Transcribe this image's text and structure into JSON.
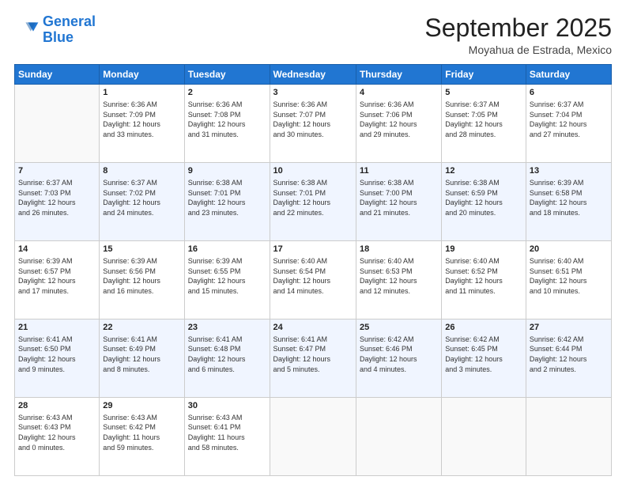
{
  "logo": {
    "line1": "General",
    "line2": "Blue"
  },
  "title": "September 2025",
  "location": "Moyahua de Estrada, Mexico",
  "days_header": [
    "Sunday",
    "Monday",
    "Tuesday",
    "Wednesday",
    "Thursday",
    "Friday",
    "Saturday"
  ],
  "weeks": [
    [
      {
        "day": "",
        "text": ""
      },
      {
        "day": "1",
        "text": "Sunrise: 6:36 AM\nSunset: 7:09 PM\nDaylight: 12 hours\nand 33 minutes."
      },
      {
        "day": "2",
        "text": "Sunrise: 6:36 AM\nSunset: 7:08 PM\nDaylight: 12 hours\nand 31 minutes."
      },
      {
        "day": "3",
        "text": "Sunrise: 6:36 AM\nSunset: 7:07 PM\nDaylight: 12 hours\nand 30 minutes."
      },
      {
        "day": "4",
        "text": "Sunrise: 6:36 AM\nSunset: 7:06 PM\nDaylight: 12 hours\nand 29 minutes."
      },
      {
        "day": "5",
        "text": "Sunrise: 6:37 AM\nSunset: 7:05 PM\nDaylight: 12 hours\nand 28 minutes."
      },
      {
        "day": "6",
        "text": "Sunrise: 6:37 AM\nSunset: 7:04 PM\nDaylight: 12 hours\nand 27 minutes."
      }
    ],
    [
      {
        "day": "7",
        "text": "Sunrise: 6:37 AM\nSunset: 7:03 PM\nDaylight: 12 hours\nand 26 minutes."
      },
      {
        "day": "8",
        "text": "Sunrise: 6:37 AM\nSunset: 7:02 PM\nDaylight: 12 hours\nand 24 minutes."
      },
      {
        "day": "9",
        "text": "Sunrise: 6:38 AM\nSunset: 7:01 PM\nDaylight: 12 hours\nand 23 minutes."
      },
      {
        "day": "10",
        "text": "Sunrise: 6:38 AM\nSunset: 7:01 PM\nDaylight: 12 hours\nand 22 minutes."
      },
      {
        "day": "11",
        "text": "Sunrise: 6:38 AM\nSunset: 7:00 PM\nDaylight: 12 hours\nand 21 minutes."
      },
      {
        "day": "12",
        "text": "Sunrise: 6:38 AM\nSunset: 6:59 PM\nDaylight: 12 hours\nand 20 minutes."
      },
      {
        "day": "13",
        "text": "Sunrise: 6:39 AM\nSunset: 6:58 PM\nDaylight: 12 hours\nand 18 minutes."
      }
    ],
    [
      {
        "day": "14",
        "text": "Sunrise: 6:39 AM\nSunset: 6:57 PM\nDaylight: 12 hours\nand 17 minutes."
      },
      {
        "day": "15",
        "text": "Sunrise: 6:39 AM\nSunset: 6:56 PM\nDaylight: 12 hours\nand 16 minutes."
      },
      {
        "day": "16",
        "text": "Sunrise: 6:39 AM\nSunset: 6:55 PM\nDaylight: 12 hours\nand 15 minutes."
      },
      {
        "day": "17",
        "text": "Sunrise: 6:40 AM\nSunset: 6:54 PM\nDaylight: 12 hours\nand 14 minutes."
      },
      {
        "day": "18",
        "text": "Sunrise: 6:40 AM\nSunset: 6:53 PM\nDaylight: 12 hours\nand 12 minutes."
      },
      {
        "day": "19",
        "text": "Sunrise: 6:40 AM\nSunset: 6:52 PM\nDaylight: 12 hours\nand 11 minutes."
      },
      {
        "day": "20",
        "text": "Sunrise: 6:40 AM\nSunset: 6:51 PM\nDaylight: 12 hours\nand 10 minutes."
      }
    ],
    [
      {
        "day": "21",
        "text": "Sunrise: 6:41 AM\nSunset: 6:50 PM\nDaylight: 12 hours\nand 9 minutes."
      },
      {
        "day": "22",
        "text": "Sunrise: 6:41 AM\nSunset: 6:49 PM\nDaylight: 12 hours\nand 8 minutes."
      },
      {
        "day": "23",
        "text": "Sunrise: 6:41 AM\nSunset: 6:48 PM\nDaylight: 12 hours\nand 6 minutes."
      },
      {
        "day": "24",
        "text": "Sunrise: 6:41 AM\nSunset: 6:47 PM\nDaylight: 12 hours\nand 5 minutes."
      },
      {
        "day": "25",
        "text": "Sunrise: 6:42 AM\nSunset: 6:46 PM\nDaylight: 12 hours\nand 4 minutes."
      },
      {
        "day": "26",
        "text": "Sunrise: 6:42 AM\nSunset: 6:45 PM\nDaylight: 12 hours\nand 3 minutes."
      },
      {
        "day": "27",
        "text": "Sunrise: 6:42 AM\nSunset: 6:44 PM\nDaylight: 12 hours\nand 2 minutes."
      }
    ],
    [
      {
        "day": "28",
        "text": "Sunrise: 6:43 AM\nSunset: 6:43 PM\nDaylight: 12 hours\nand 0 minutes."
      },
      {
        "day": "29",
        "text": "Sunrise: 6:43 AM\nSunset: 6:42 PM\nDaylight: 11 hours\nand 59 minutes."
      },
      {
        "day": "30",
        "text": "Sunrise: 6:43 AM\nSunset: 6:41 PM\nDaylight: 11 hours\nand 58 minutes."
      },
      {
        "day": "",
        "text": ""
      },
      {
        "day": "",
        "text": ""
      },
      {
        "day": "",
        "text": ""
      },
      {
        "day": "",
        "text": ""
      }
    ]
  ]
}
